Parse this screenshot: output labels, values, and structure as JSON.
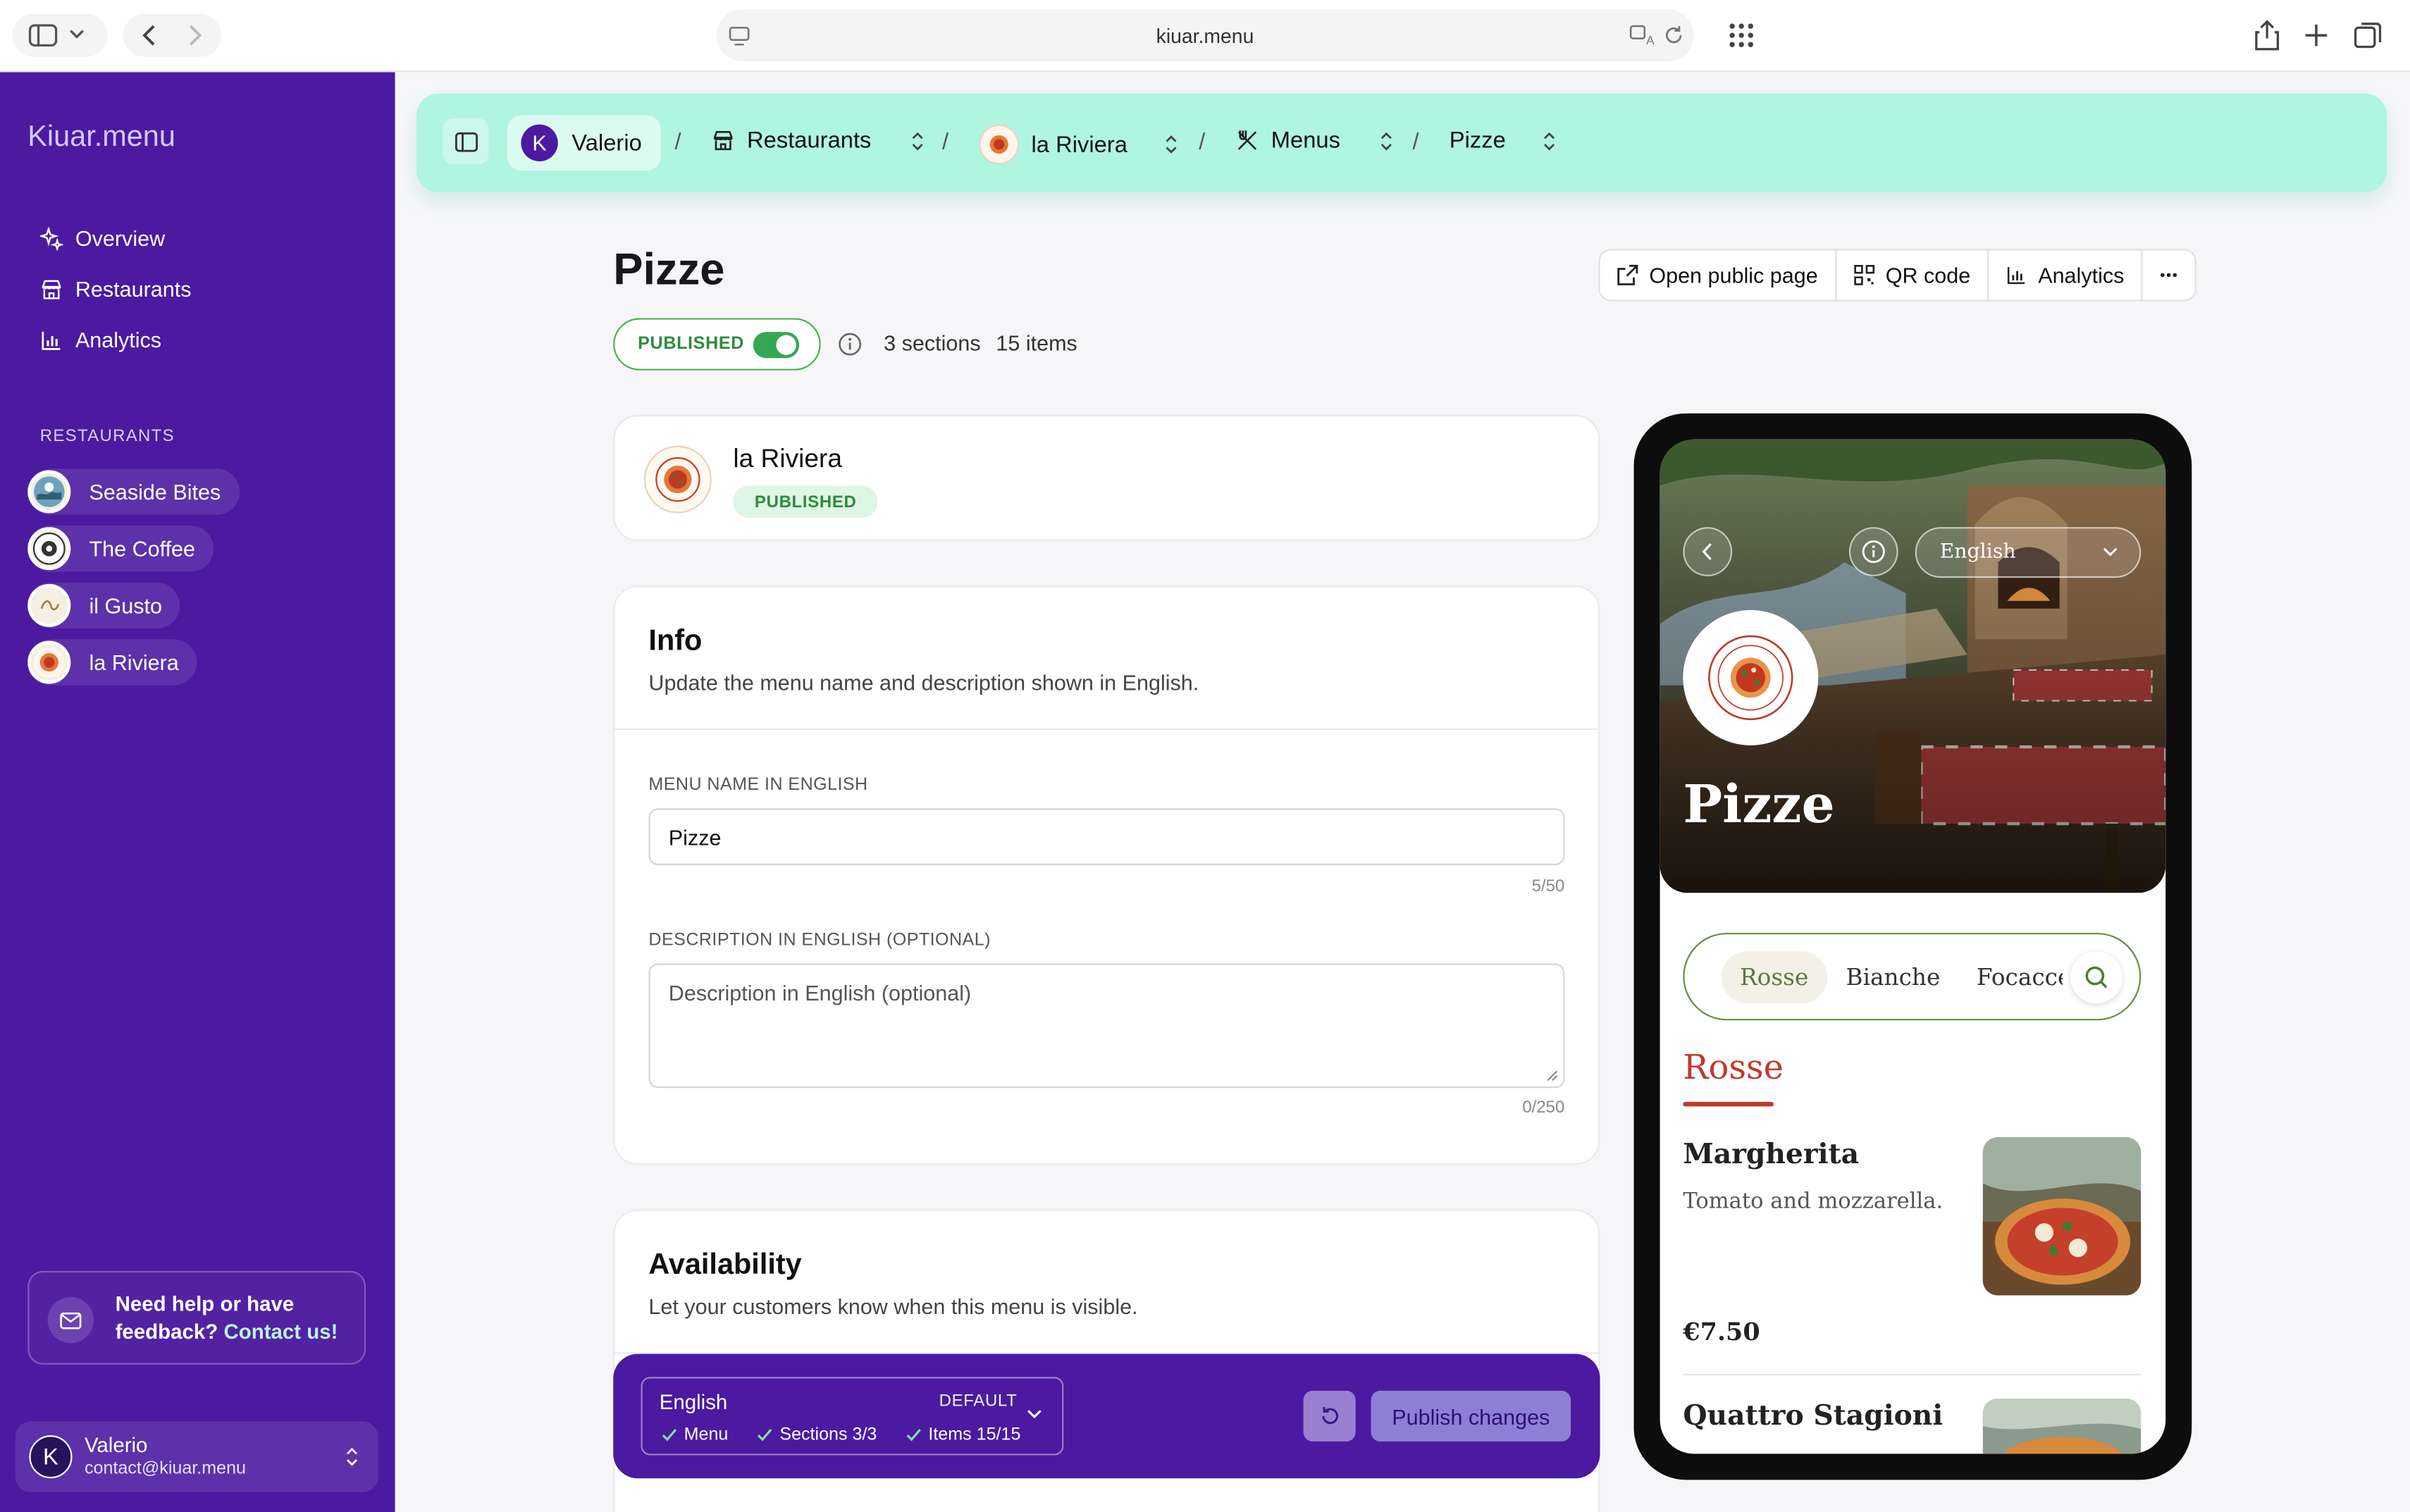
{
  "browser": {
    "url": "kiuar.menu"
  },
  "sidebar": {
    "brand": "Kiuar.menu",
    "nav": [
      {
        "label": "Overview",
        "icon": "sparkle-icon"
      },
      {
        "label": "Restaurants",
        "icon": "store-icon"
      },
      {
        "label": "Analytics",
        "icon": "bar-chart-icon"
      }
    ],
    "restaurants_heading": "RESTAURANTS",
    "restaurants": [
      {
        "name": "Seaside Bites"
      },
      {
        "name": "The Coffee"
      },
      {
        "name": "il Gusto"
      },
      {
        "name": "la Riviera"
      }
    ],
    "help": {
      "text": "Need help or have feedback?",
      "link": "Contact us!"
    },
    "user": {
      "initial": "K",
      "name": "Valerio",
      "email": "contact@kiuar.menu"
    }
  },
  "breadcrumb": {
    "account": {
      "initial": "K",
      "label": "Valerio"
    },
    "restaurants": "Restaurants",
    "restaurant": "la Riviera",
    "menus": "Menus",
    "menu": "Pizze",
    "separator": "/"
  },
  "header": {
    "title": "Pizze",
    "status": "PUBLISHED",
    "published": true,
    "sections": "3 sections",
    "items": "15 items",
    "actions": {
      "open": "Open public page",
      "qr": "QR code",
      "analytics": "Analytics"
    }
  },
  "restaurant_card": {
    "name": "la Riviera",
    "badge": "PUBLISHED"
  },
  "info": {
    "heading": "Info",
    "subtitle": "Update the menu name and description shown in English.",
    "name_label": "MENU NAME IN ENGLISH",
    "name_value": "Pizze",
    "name_counter": "5/50",
    "desc_label": "DESCRIPTION IN ENGLISH (OPTIONAL)",
    "desc_placeholder": "Description in English (optional)",
    "desc_counter": "0/250"
  },
  "availability": {
    "heading": "Availability",
    "subtitle": "Let your customers know when this menu is visible."
  },
  "publish_bar": {
    "language": "English",
    "default": "DEFAULT",
    "checks": [
      "Menu",
      "Sections 3/3",
      "Items 15/15"
    ],
    "publish": "Publish changes"
  },
  "preview": {
    "language": "English",
    "title": "Pizze",
    "tabs": [
      "Rosse",
      "Bianche",
      "Focacce"
    ],
    "section": "Rosse",
    "items": [
      {
        "name": "Margherita",
        "description": "Tomato and mozzarella.",
        "price": "€7.50"
      },
      {
        "name": "Quattro Stagioni"
      }
    ]
  },
  "colors": {
    "sidebar": "#4b1aa0",
    "breadcrumb_bg": "#aff5e0",
    "published_green": "#34a853",
    "preview_accent": "#c0392b"
  }
}
